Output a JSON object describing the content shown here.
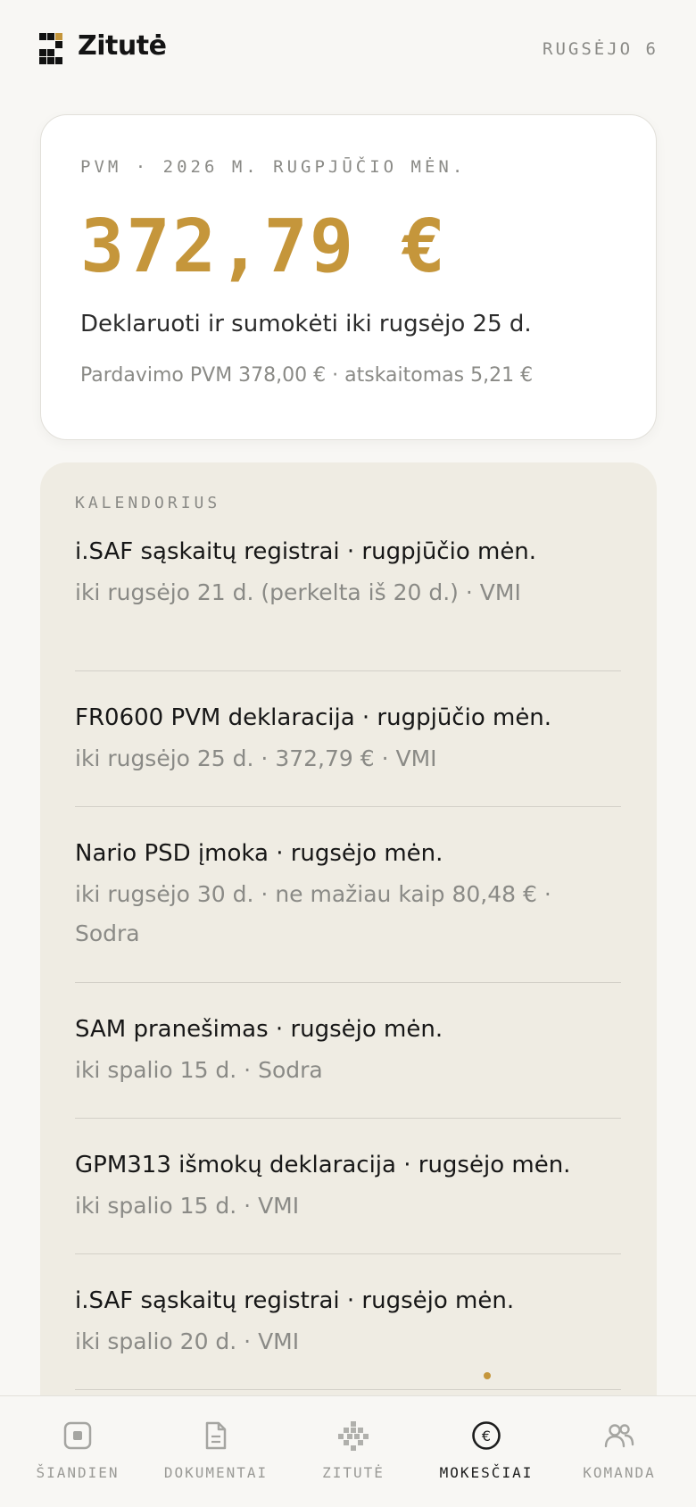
{
  "header": {
    "brand": "Zitutė",
    "date": "RUGSĖJO 6"
  },
  "summary": {
    "label": "PVM · 2026 M. RUGPJŪČIO MĖN.",
    "amount": "372,79 €",
    "deadline": "Deklaruoti ir sumokėti iki rugsėjo 25 d.",
    "breakdown": "Pardavimo PVM 378,00 € · atskaitomas 5,21 €"
  },
  "calendar": {
    "title": "KALENDORIUS",
    "items": [
      {
        "title": "i.SAF sąskaitų registrai · rugpjūčio mėn.",
        "meta": "iki rugsėjo 21 d. (perkelta iš 20 d.) · VMI"
      },
      {
        "title": "FR0600 PVM deklaracija · rugpjūčio mėn.",
        "meta": "iki rugsėjo 25 d. · 372,79 € · VMI"
      },
      {
        "title": "Nario PSD įmoka · rugsėjo mėn.",
        "meta": "iki rugsėjo 30 d. · ne mažiau kaip 80,48 € · Sodra"
      },
      {
        "title": "SAM pranešimas · rugsėjo mėn.",
        "meta": "iki spalio 15 d. · Sodra"
      },
      {
        "title": "GPM313 išmokų deklaracija · rugsėjo mėn.",
        "meta": "iki spalio 15 d. · VMI"
      },
      {
        "title": "i.SAF sąskaitų registrai · rugsėjo mėn.",
        "meta": "iki spalio 20 d. · VMI"
      }
    ]
  },
  "nav": {
    "items": [
      {
        "label": "ŠIANDIEN",
        "icon": "today-icon"
      },
      {
        "label": "DOKUMENTAI",
        "icon": "document-icon"
      },
      {
        "label": "ZITUTĖ",
        "icon": "zitute-icon"
      },
      {
        "label": "MOKESČIAI",
        "icon": "euro-icon",
        "active": true
      },
      {
        "label": "KOMANDA",
        "icon": "team-icon"
      }
    ]
  },
  "colors": {
    "accent": "#c5963b",
    "background": "#f8f7f4",
    "card": "#ffffff",
    "calendar_bg": "#efece3",
    "muted_text": "#8a8a86"
  }
}
